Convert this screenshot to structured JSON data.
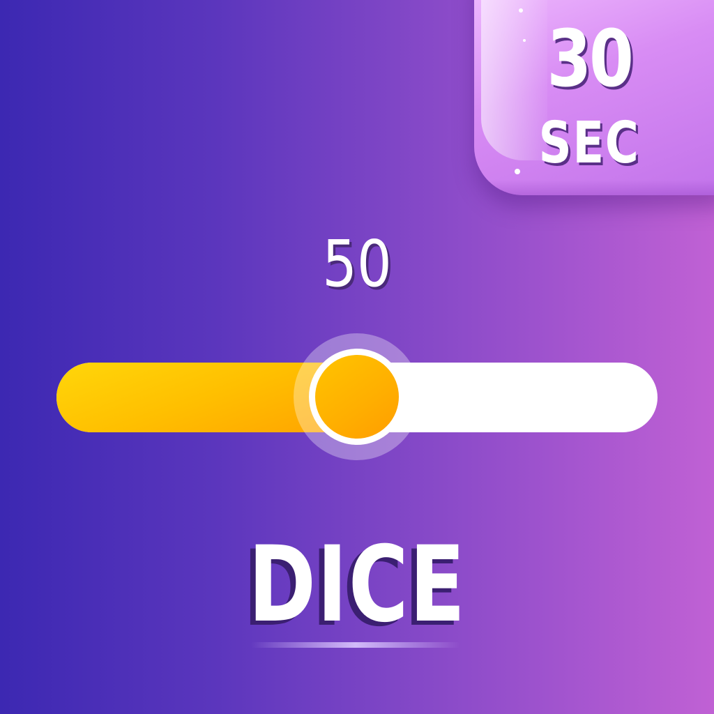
{
  "timer": {
    "value": "30",
    "unit": "SEC"
  },
  "slider": {
    "value_label": "50",
    "value": 50,
    "min": 0,
    "max": 100,
    "fill_color": "#ffb400",
    "track_color": "#ffffff"
  },
  "title": "DICE",
  "colors": {
    "background_start": "#3c28b2",
    "background_end": "#c061d4",
    "badge": "#d88cf4"
  }
}
